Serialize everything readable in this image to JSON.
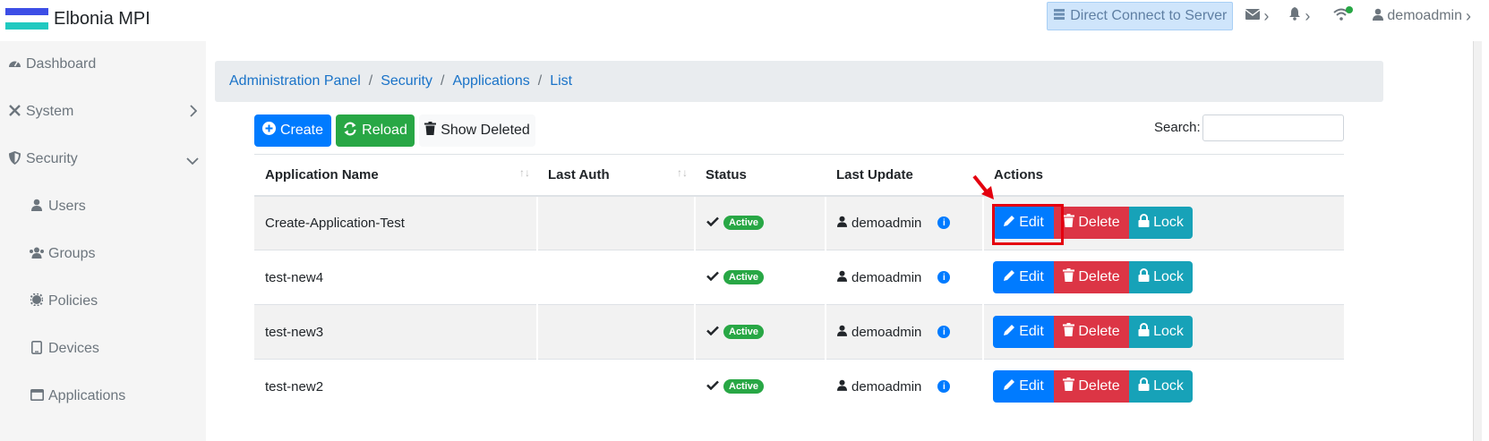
{
  "app": {
    "title": "Elbonia MPI",
    "flag_colors": [
      "#3d4ee6",
      "#ffffff",
      "#20c9c0"
    ]
  },
  "topbar": {
    "direct_connect_label": "Direct Connect to Server",
    "username": "demoadmin",
    "wifi_status_color": "#28a745"
  },
  "sidebar": {
    "items": [
      {
        "label": "Dashboard",
        "icon": "dashboard-icon"
      },
      {
        "label": "System",
        "icon": "tools-icon",
        "expand": "chevron-right-icon"
      },
      {
        "label": "Security",
        "icon": "shield-icon",
        "expand": "chevron-down-icon"
      },
      {
        "label": "Users",
        "icon": "user-icon"
      },
      {
        "label": "Groups",
        "icon": "users-icon"
      },
      {
        "label": "Policies",
        "icon": "gear-icon"
      },
      {
        "label": "Devices",
        "icon": "tablet-icon"
      },
      {
        "label": "Applications",
        "icon": "window-icon"
      }
    ]
  },
  "breadcrumb": [
    "Administration Panel",
    "Security",
    "Applications",
    "List"
  ],
  "toolbar": {
    "create_label": "Create",
    "reload_label": "Reload",
    "show_deleted_label": "Show Deleted",
    "search_label": "Search:",
    "search_value": ""
  },
  "table": {
    "columns": [
      "Application Name",
      "Last Auth",
      "Status",
      "Last Update",
      "Actions"
    ],
    "rows": [
      {
        "name": "Create-Application-Test",
        "last_auth": "",
        "status": "Active",
        "updated_by": "demoadmin"
      },
      {
        "name": "test-new4",
        "last_auth": "",
        "status": "Active",
        "updated_by": "demoadmin"
      },
      {
        "name": "test-new3",
        "last_auth": "",
        "status": "Active",
        "updated_by": "demoadmin"
      },
      {
        "name": "test-new2",
        "last_auth": "",
        "status": "Active",
        "updated_by": "demoadmin"
      }
    ],
    "action_labels": {
      "edit": "Edit",
      "delete": "Delete",
      "lock": "Lock"
    }
  },
  "colors": {
    "primary": "#007bff",
    "success": "#28a745",
    "danger": "#dc3545",
    "info": "#17a2b8",
    "highlight": "#e4000f"
  }
}
